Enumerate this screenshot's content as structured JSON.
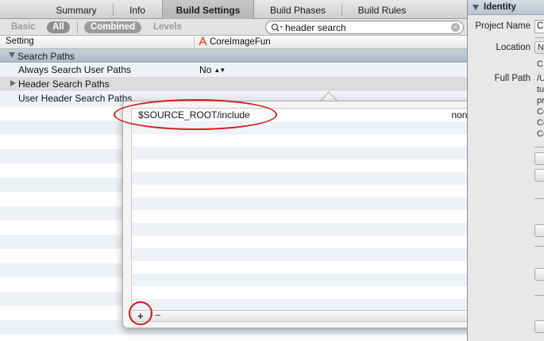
{
  "tabs": {
    "summary": "Summary",
    "info": "Info",
    "build_settings": "Build Settings",
    "build_phases": "Build Phases",
    "build_rules": "Build Rules"
  },
  "filters": {
    "basic": "Basic",
    "all": "All",
    "combined": "Combined",
    "levels": "Levels"
  },
  "search": {
    "value": "header search"
  },
  "columns": {
    "setting": "Setting",
    "target": "CoreImageFun"
  },
  "group": {
    "title": "Search Paths"
  },
  "rows": [
    {
      "name": "Always Search User Paths",
      "value": "No"
    },
    {
      "name": "Header Search Paths",
      "value": ""
    },
    {
      "name": "User Header Search Paths",
      "value": ""
    }
  ],
  "popover": {
    "path": "$SOURCE_ROOT/include",
    "recursion": "non-recursive",
    "add_symbol": "+",
    "remove_symbol": "−"
  },
  "inspector": {
    "section_title": "Identity",
    "project_name_label": "Project Name",
    "project_name_value": "C",
    "location_label": "Location",
    "location_value": "N",
    "full_path_label": "Full Path",
    "full_path_lines": [
      "C",
      "/U",
      "tu",
      "pr",
      "Co",
      "Co",
      "Co"
    ]
  },
  "colors": {
    "annotation": "#d41c1c",
    "group_header": "#b9c3cf",
    "selected_pill": "#8e8e8e"
  },
  "icons": {
    "target": "xcode-target-icon",
    "search": "search-icon",
    "clear": "clear-icon"
  }
}
